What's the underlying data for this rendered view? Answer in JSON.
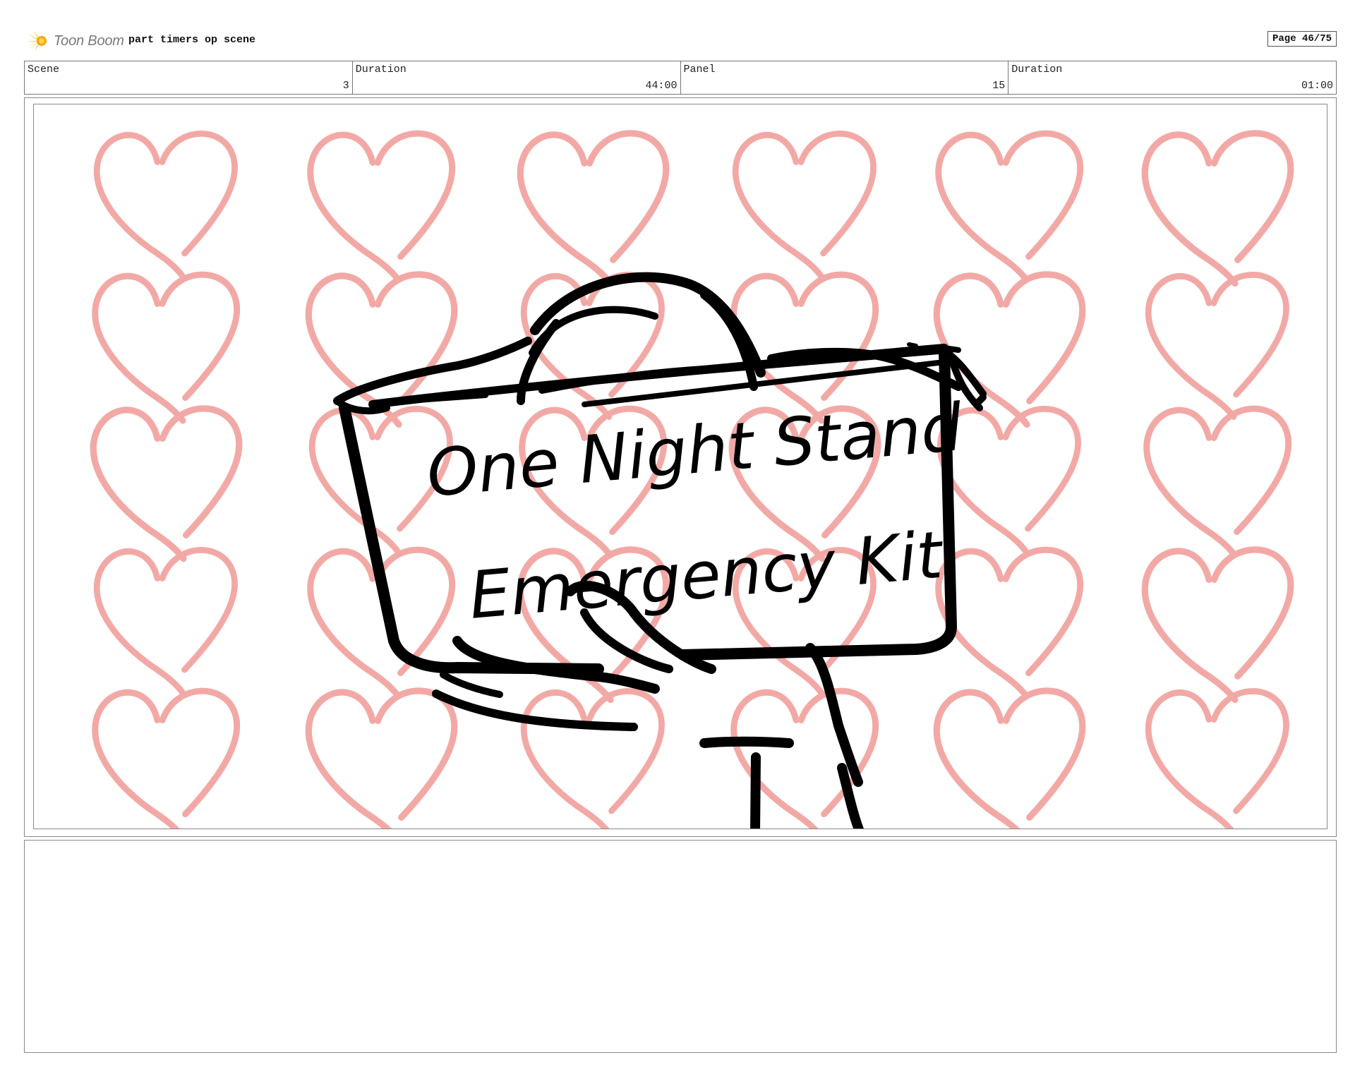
{
  "header": {
    "brand": "Toon Boom",
    "project_title": "part timers op scene",
    "page_label": "Page 46/75"
  },
  "info": [
    {
      "label": "Scene",
      "value": "3"
    },
    {
      "label": "Duration",
      "value": "44:00"
    },
    {
      "label": "Panel",
      "value": "15"
    },
    {
      "label": "Duration",
      "value": "01:00"
    }
  ],
  "panel": {
    "sign_line_1": "One Night Stand",
    "sign_line_2": "Emergency Kit",
    "heart_color": "#f2a9a6",
    "ink_color": "#000000"
  },
  "notes": {
    "text": ""
  }
}
